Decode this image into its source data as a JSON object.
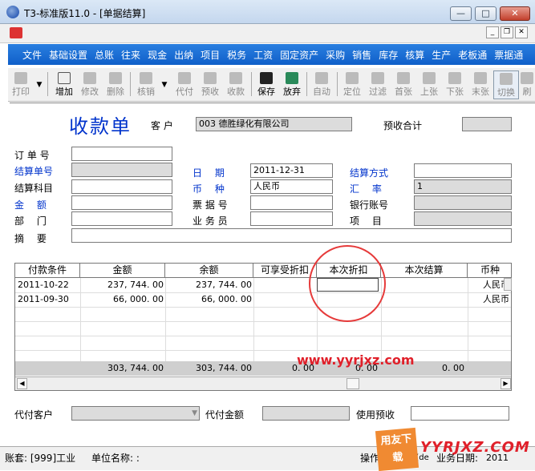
{
  "window": {
    "title": "T3-标准版11.0 - [单据结算]",
    "minimize": "—",
    "maximize": "□",
    "close": "✕"
  },
  "mdi": {
    "minimize": "_",
    "restore": "❐",
    "close": "✕"
  },
  "menu": [
    "文件",
    "基础设置",
    "总账",
    "往来",
    "现金",
    "出纳",
    "项目",
    "税务",
    "工资",
    "固定资产",
    "采购",
    "销售",
    "库存",
    "核算",
    "生产",
    "老板通",
    "票据通"
  ],
  "toolbar": {
    "print": "打印",
    "add": "增加",
    "modify": "修改",
    "delete": "删除",
    "writeoff": "核销",
    "proxy": "代付",
    "prepay": "预收",
    "receipt": "收款",
    "save": "保存",
    "abandon": "放弃",
    "auto": "自动",
    "locate": "定位",
    "filter": "过滤",
    "first": "首张",
    "prev": "上张",
    "next": "下张",
    "last": "末张",
    "switch": "切换",
    "refresh": "刷"
  },
  "form": {
    "title": "收款单",
    "customer_label": "客 户",
    "customer_value": "003  德胜绿化有限公司",
    "prepay_total_label": "预收合计",
    "order_no_label": "订 单 号",
    "settle_no_label": "结算单号",
    "date_label": "日　 期",
    "date_value": "2011-12-31",
    "settle_method_label": "结算方式",
    "settle_subject_label": "结算科目",
    "currency_label": "币　 种",
    "currency_value": "人民币",
    "rate_label": "汇　 率",
    "rate_value": "1",
    "amount_label": "金　 额",
    "bill_no_label": "票 据 号",
    "bank_account_label": "银行账号",
    "dept_label": "部　 门",
    "salesman_label": "业 务 员",
    "project_label": "项　 目",
    "memo_label": "摘　 要"
  },
  "grid": {
    "headers": [
      "付款条件",
      "金额",
      "余额",
      "可享受折扣",
      "本次折扣",
      "本次结算",
      "币种"
    ],
    "rows": [
      [
        "2011-10-22",
        "237, 744. 00",
        "237, 744. 00",
        "",
        "",
        "",
        "人民币"
      ],
      [
        "2011-09-30",
        "66, 000. 00",
        "66, 000. 00",
        "",
        "",
        "",
        "人民币"
      ]
    ],
    "totals": [
      "",
      "303, 744. 00",
      "303, 744. 00",
      "0. 00",
      "0. 00",
      "0. 00",
      ""
    ]
  },
  "watermark": "www.yyrjxz.com",
  "bottom": {
    "proxy_customer_label": "代付客户",
    "proxy_amount_label": "代付金额",
    "use_prepay_label": "使用预收"
  },
  "statusbar": {
    "account": "账套: [999]工业",
    "unit": "单位名称: :",
    "operator": "操作员",
    "operator_value": "demo(de",
    "business_date": "业务日期:",
    "business_date_value": "2011",
    "logo_text": "用友下载",
    "site_text": "YYRJXZ.COM"
  }
}
